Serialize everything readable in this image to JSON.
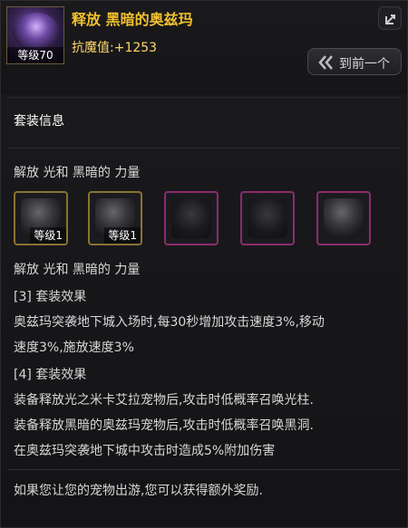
{
  "header": {
    "title": "释放 黑暗的奥兹玛",
    "stat_line": "抗魔值:+1253",
    "avatar_level": "等级70",
    "prev_button_label": "到前一个"
  },
  "set": {
    "section_title": "套装信息",
    "liberation_title_1": "解放 光和 黑暗的 力量",
    "liberation_title_2": "解放 光和 黑暗的 力量",
    "icons": [
      {
        "name": "set-item-1",
        "level": "等级1",
        "border": "#8a7331"
      },
      {
        "name": "set-item-2",
        "level": "等级1",
        "border": "#8a7331"
      },
      {
        "name": "set-item-3",
        "level": "",
        "border": "#8b2c6e"
      },
      {
        "name": "set-item-4",
        "level": "",
        "border": "#8b2c6e"
      },
      {
        "name": "set-item-5",
        "level": "",
        "border": "#8b2c6e"
      }
    ],
    "effect3": {
      "header": "[3] 套装效果",
      "line1": "奥兹玛突袭地下城入场时,每30秒增加攻击速度3%,移动",
      "line2": "速度3%,施放速度3%"
    },
    "effect4": {
      "header": "[4] 套装效果",
      "line1": "装备释放光之米卡艾拉宠物后,攻击时低概率召唤光柱.",
      "line2": "装备释放黑暗的奥兹玛宠物后,攻击时低概率召唤黑洞.",
      "line3": "在奥兹玛突袭地下城中攻击时造成5%附加伤害"
    },
    "footer_note": "如果您让您的宠物出游,您可以获得额外奖励."
  },
  "colors": {
    "title": "#f2c12e",
    "stat": "#ffd56b",
    "text": "#d7d7d7",
    "gold_border": "#8a7331",
    "pink_border": "#8b2c6e"
  }
}
